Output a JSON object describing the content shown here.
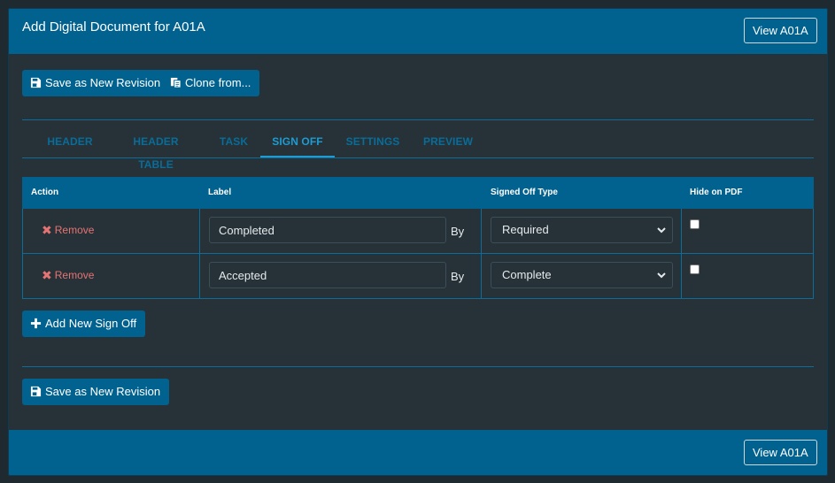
{
  "header": {
    "title": "Add Digital Document for A01A",
    "view_button": "View A01A"
  },
  "toolbar": {
    "save_revision": "Save as New Revision",
    "clone_from": "Clone from..."
  },
  "tabs": [
    {
      "label": "HEADER"
    },
    {
      "label": "HEADER TABLE"
    },
    {
      "label": "TASK"
    },
    {
      "label": "SIGN OFF",
      "active": true
    },
    {
      "label": "SETTINGS"
    },
    {
      "label": "PREVIEW"
    }
  ],
  "table": {
    "columns": [
      "Action",
      "Label",
      "Signed Off Type",
      "Hide on PDF"
    ],
    "rows": [
      {
        "action": "Remove",
        "label": "Completed",
        "by": "By",
        "signed_off_type": "Required",
        "hide_on_pdf": false
      },
      {
        "action": "Remove",
        "label": "Accepted",
        "by": "By",
        "signed_off_type": "Complete",
        "hide_on_pdf": false
      }
    ]
  },
  "add_sign_off": "Add New Sign Off",
  "bottom_save_revision": "Save as New Revision",
  "footer": {
    "view_button": "View A01A"
  },
  "colors": {
    "primary": "#01628f",
    "remove": "#e57373",
    "panel_bg": "#263238"
  }
}
